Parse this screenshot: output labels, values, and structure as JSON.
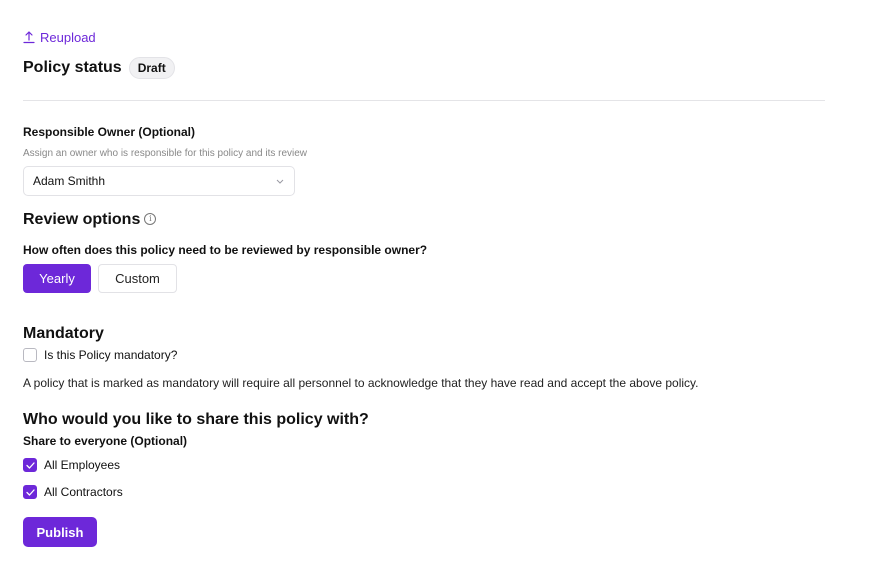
{
  "reupload": {
    "label": "Reupload",
    "icon": "upload-icon"
  },
  "policy_status": {
    "title": "Policy status",
    "badge": "Draft"
  },
  "owner": {
    "label": "Responsible Owner (Optional)",
    "help": "Assign an owner who is responsible for this policy and its review",
    "selected": "Adam Smithh"
  },
  "review": {
    "title": "Review options",
    "question": "How often does this policy need to be reviewed by responsible owner?",
    "options": [
      "Yearly",
      "Custom"
    ],
    "selected": "Yearly"
  },
  "mandatory": {
    "title": "Mandatory",
    "checkbox_label": "Is this Policy mandatory?",
    "checked": false,
    "description": "A policy that is marked as mandatory will require all personnel to acknowledge that they have read and accept the above policy."
  },
  "share": {
    "title": "Who would you like to share this policy with?",
    "subtitle": "Share to everyone (Optional)",
    "options": [
      {
        "label": "All Employees",
        "checked": true
      },
      {
        "label": "All Contractors",
        "checked": true
      }
    ]
  },
  "publish_label": "Publish",
  "colors": {
    "accent": "#6d28d9",
    "divider": "#e4e4e7",
    "muted": "#888888"
  }
}
